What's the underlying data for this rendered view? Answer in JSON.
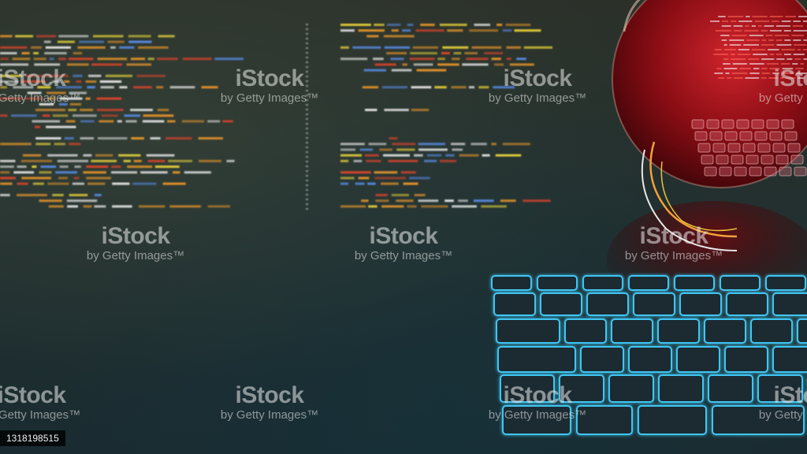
{
  "watermark": {
    "brand": "iStock",
    "credit": "by Getty Images™"
  },
  "image_id": "1318198515",
  "colors": {
    "background": "#23302f",
    "code_orange": "#e8962a",
    "code_yellow": "#e8d23a",
    "code_white": "#e8e8e8",
    "code_red": "#e0452c",
    "code_blue": "#5a8de8",
    "key_glow": "#3fc6f2",
    "key_fill": "#1f2b30",
    "sphere_red": "#c2161e",
    "ring_orange": "#f0a23a",
    "ring_white": "#e8e8e8"
  }
}
